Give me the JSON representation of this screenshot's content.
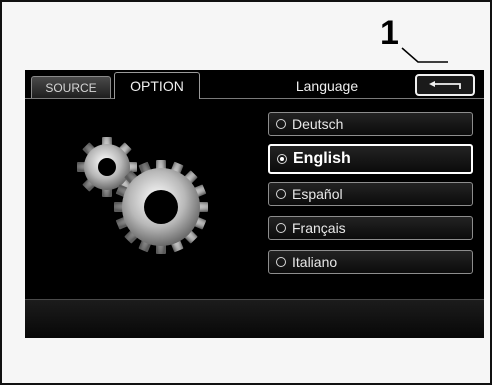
{
  "callout": {
    "number": "1"
  },
  "tabs": [
    {
      "label": "SOURCE",
      "active": false
    },
    {
      "label": "OPTION",
      "active": true
    }
  ],
  "header": {
    "title": "Language",
    "back_icon": "back-arrow-icon"
  },
  "illustration": {
    "icon": "gears-icon"
  },
  "languages": [
    {
      "label": "Deutsch",
      "selected": false
    },
    {
      "label": "English",
      "selected": true
    },
    {
      "label": "Español",
      "selected": false
    },
    {
      "label": "Français",
      "selected": false
    },
    {
      "label": "Italiano",
      "selected": false
    }
  ],
  "colors": {
    "screen_bg": "#000000",
    "text": "#e8e8e8",
    "highlight": "#ffffff"
  }
}
